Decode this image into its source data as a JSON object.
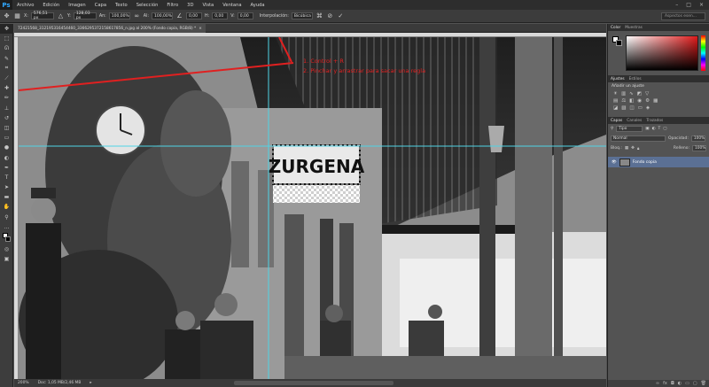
{
  "app": {
    "logo": "Ps"
  },
  "menu": [
    "Archivo",
    "Edición",
    "Imagen",
    "Capa",
    "Texto",
    "Selección",
    "Filtro",
    "3D",
    "Vista",
    "Ventana",
    "Ayuda"
  ],
  "window_controls": [
    "–",
    "□",
    "×"
  ],
  "options_bar": {
    "x_label": "X:",
    "x_value": "576,51 px",
    "y_label": "Y:",
    "y_value": "128,03 px",
    "w_label": "An:",
    "w_value": "100,00%",
    "h_label": "Al:",
    "h_value": "100,00%",
    "angle_value": "0,00",
    "hskew_label": "H:",
    "hskew_value": "0,00",
    "vskew_label": "V:",
    "vskew_value": "0,00",
    "interp_label": "Interpolación:",
    "interp_value": "Bicúbica",
    "search_placeholder": "Aspectos esen..."
  },
  "document": {
    "tab_title": "72421568_312195316454460_3366295372158617856_n.jpg al 200% (Fondo copia, RGB/8) *",
    "zoom": "200%",
    "doc_info": "Doc: 1,05 MB/2,46 MB"
  },
  "annotations": {
    "step1": "1. Control + R",
    "step2": "2. Pinchar y arrastrar para sacar una regla",
    "sign_text": "ZURGENA",
    "annotation_color": "#e02020",
    "guide_color": "#4fd4e6"
  },
  "panels": {
    "color_tabs": [
      "Color",
      "Muestras"
    ],
    "adjust_tabs": [
      "Ajustes",
      "Estilos"
    ],
    "adjust_title": "Añadir un ajuste",
    "layers_tabs": [
      "Capas",
      "Canales",
      "Trazados"
    ],
    "filter_label": "Tipo",
    "blend_mode": "Normal",
    "opacity_label": "Opacidad:",
    "opacity_value": "100%",
    "lock_label": "Bloq.:",
    "fill_label": "Relleno:",
    "fill_value": "100%",
    "layer_name": "Fondo copia"
  }
}
